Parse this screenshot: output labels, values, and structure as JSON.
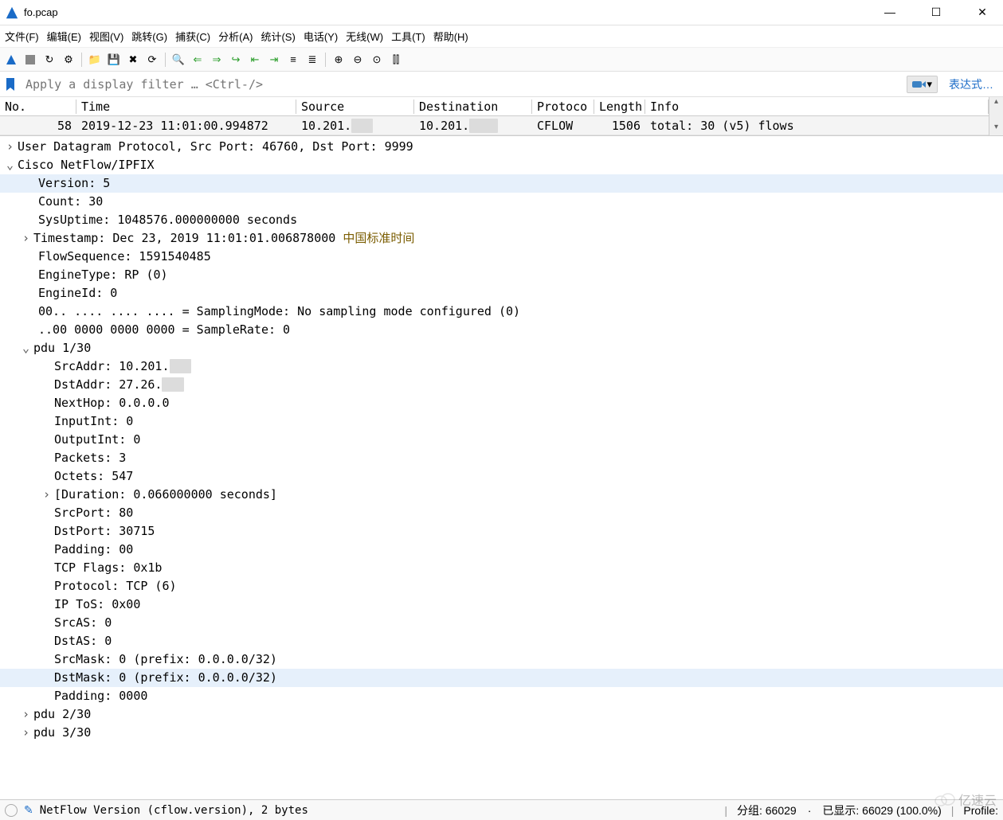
{
  "window": {
    "title": "fo.pcap",
    "min_label": "—",
    "max_label": "☐",
    "close_label": "✕"
  },
  "menu": {
    "file": "文件(F)",
    "edit": "编辑(E)",
    "view": "视图(V)",
    "go": "跳转(G)",
    "capture": "捕获(C)",
    "analyze": "分析(A)",
    "statistics": "统计(S)",
    "telephony": "电话(Y)",
    "wireless": "无线(W)",
    "tools": "工具(T)",
    "help": "帮助(H)"
  },
  "filter": {
    "placeholder": "Apply a display filter … <Ctrl-/>",
    "expression_label": "表达式…"
  },
  "columns": {
    "no": "No.",
    "time": "Time",
    "source": "Source",
    "destination": "Destination",
    "protocol": "Protoco",
    "length": "Length",
    "info": "Info"
  },
  "packet": {
    "no": "58",
    "time": "2019-12-23 11:01:00.994872",
    "source": "10.201.",
    "destination": "10.201.",
    "protocol": "CFLOW",
    "length": "1506",
    "info": "total: 30 (v5) flows"
  },
  "detail": {
    "udp": "User Datagram Protocol, Src Port: 46760, Dst Port: 9999",
    "netflow_header": "Cisco NetFlow/IPFIX",
    "version": "Version: 5",
    "count": "Count: 30",
    "sysuptime": "SysUptime: 1048576.000000000 seconds",
    "timestamp_main": "Timestamp: Dec 23, 2019 11:01:01.006878000 ",
    "timestamp_zone": "中国标准时间",
    "flowsequence": "FlowSequence: 1591540485",
    "enginetype": "EngineType: RP (0)",
    "engineid": "EngineId: 0",
    "samplingmode": "00.. .... .... .... = SamplingMode: No sampling mode configured (0)",
    "samplerate": "..00 0000 0000 0000 = SampleRate: 0",
    "pdu1": "pdu 1/30",
    "srcaddr": "SrcAddr: 10.201.",
    "dstaddr": "DstAddr: 27.26.",
    "nexthop": "NextHop: 0.0.0.0",
    "inputint": "InputInt: 0",
    "outputint": "OutputInt: 0",
    "packets": "Packets: 3",
    "octets": "Octets: 547",
    "duration": "[Duration: 0.066000000 seconds]",
    "srcport": "SrcPort: 80",
    "dstport": "DstPort: 30715",
    "padding1": "Padding: 00",
    "tcpflags": "TCP Flags: 0x1b",
    "protocol": "Protocol: TCP (6)",
    "iptos": "IP ToS: 0x00",
    "srcas": "SrcAS: 0",
    "dstas": "DstAS: 0",
    "srcmask": "SrcMask: 0 (prefix: 0.0.0.0/32)",
    "dstmask": "DstMask: 0 (prefix: 0.0.0.0/32)",
    "padding2": "Padding: 0000",
    "pdu2": "pdu 2/30",
    "pdu3": "pdu 3/30"
  },
  "status": {
    "field": "NetFlow Version (cflow.version), 2 bytes",
    "packets": "分组: 66029",
    "displayed": "已显示: 66029 (100.0%)",
    "profile": "Profile:"
  },
  "watermark": "亿速云",
  "icons": {
    "shark": "shark-fin-icon",
    "bookmark": "bookmark-icon",
    "arrow": "arrow-icon"
  }
}
